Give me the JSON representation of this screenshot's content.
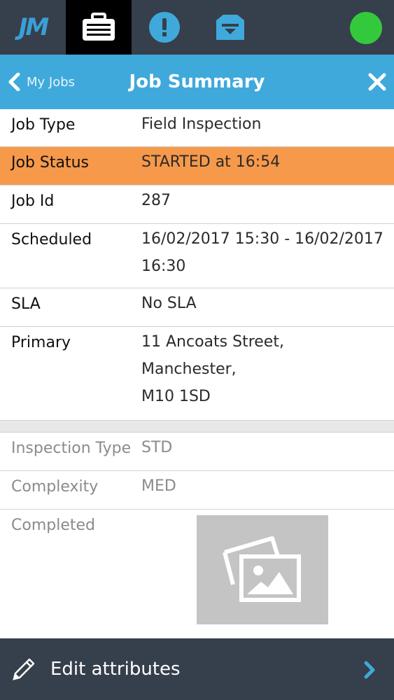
{
  "topnav": {
    "logo": "JM",
    "items": [
      {
        "icon": "briefcase-icon",
        "active": true
      },
      {
        "icon": "alert-icon",
        "active": false
      },
      {
        "icon": "inbox-icon",
        "active": false
      }
    ],
    "status_color": "#34c93c"
  },
  "header": {
    "back_label": "My Jobs",
    "title": "Job Summary"
  },
  "details": {
    "job_type": {
      "label": "Job Type",
      "value": "Field Inspection"
    },
    "job_status": {
      "label": "Job Status",
      "value": "STARTED at 16:54"
    },
    "job_id": {
      "label": "Job Id",
      "value": "287"
    },
    "scheduled": {
      "label": "Scheduled",
      "value": "16/02/2017 15:30 - 16/02/2017 16:30"
    },
    "sla": {
      "label": "SLA",
      "value": "No SLA"
    },
    "primary": {
      "label": "Primary",
      "address_line1": "11  Ancoats Street,",
      "address_line2": "Manchester,",
      "address_line3": "M10 1SD"
    }
  },
  "attributes": {
    "inspection_type": {
      "label": "Inspection Type",
      "value": "STD"
    },
    "complexity": {
      "label": "Complexity",
      "value": "MED"
    },
    "completed": {
      "label": "Completed"
    }
  },
  "footer": {
    "edit_label": "Edit attributes"
  },
  "colors": {
    "nav_bg": "#363f4c",
    "accent": "#3fa9dc",
    "status_row": "#f6994a"
  }
}
